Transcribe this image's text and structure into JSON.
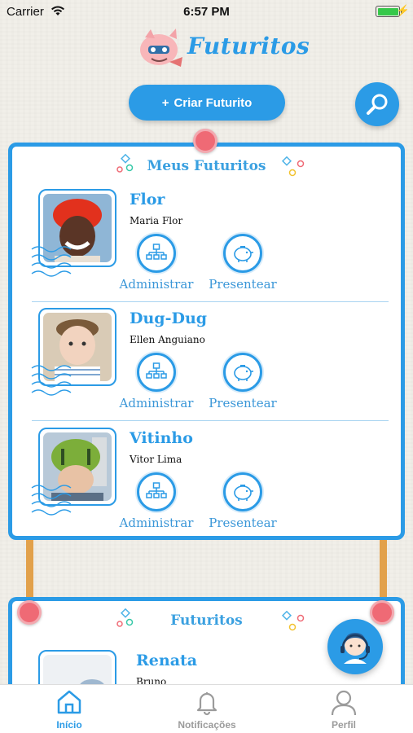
{
  "status_bar": {
    "carrier": "Carrier",
    "time": "6:57 PM"
  },
  "app": {
    "logo_text": "Futuritos"
  },
  "actions": {
    "create_label": "Criar Futurito",
    "create_icon": "+"
  },
  "my_futuritos": {
    "title": "Meus Futuritos",
    "children": [
      {
        "nickname": "Flor",
        "full_name": "Maria Flor",
        "admin_label": "Administrar",
        "gift_label": "Presentear"
      },
      {
        "nickname": "Dug-Dug",
        "full_name": "Ellen Anguiano",
        "admin_label": "Administrar",
        "gift_label": "Presentear"
      },
      {
        "nickname": "Vitinho",
        "full_name": "Vitor Lima",
        "admin_label": "Administrar",
        "gift_label": "Presentear"
      }
    ]
  },
  "futuritos": {
    "title": "Futuritos",
    "children": [
      {
        "nickname": "Renata",
        "full_name": "Bruno"
      }
    ]
  },
  "tabbar": {
    "items": [
      {
        "label": "Início",
        "icon": "home-icon",
        "active": true
      },
      {
        "label": "Notificações",
        "icon": "bell-icon",
        "active": false
      },
      {
        "label": "Perfil",
        "icon": "profile-icon",
        "active": false
      }
    ]
  },
  "colors": {
    "primary": "#2b9be6",
    "pin": "#ef6a75",
    "pole": "#e2a14b",
    "background": "#f1efe9"
  }
}
